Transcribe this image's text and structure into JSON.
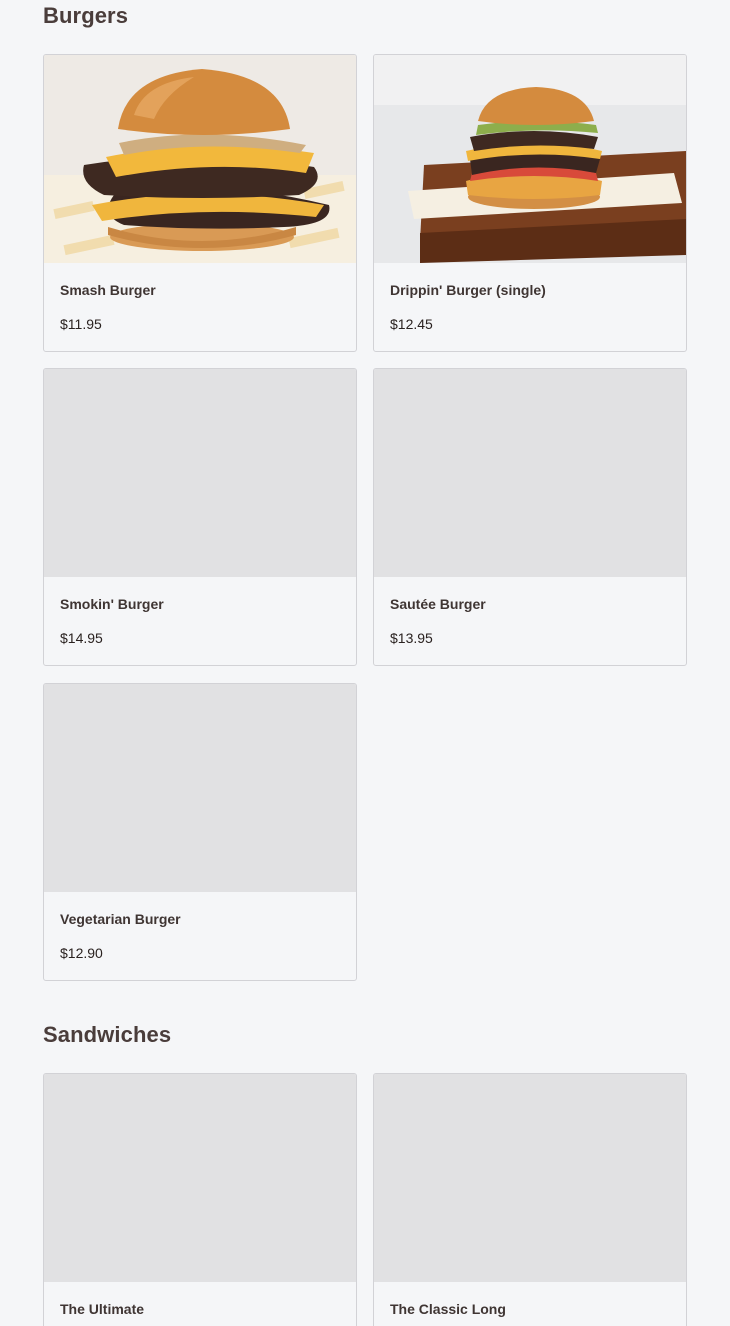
{
  "sections": [
    {
      "title": "Burgers",
      "items": [
        {
          "name": "Smash Burger",
          "price": "$11.95",
          "image": "smash-burger-photo"
        },
        {
          "name": "Drippin' Burger (single)",
          "price": "$12.45",
          "image": "drippin-burger-photo"
        },
        {
          "name": "Smokin' Burger",
          "price": "$14.95",
          "image": "placeholder"
        },
        {
          "name": "Sautée Burger",
          "price": "$13.95",
          "image": "placeholder"
        },
        {
          "name": "Vegetarian Burger",
          "price": "$12.90",
          "image": "placeholder"
        }
      ]
    },
    {
      "title": "Sandwiches",
      "items": [
        {
          "name": "The Ultimate",
          "image": "placeholder"
        },
        {
          "name": "The Classic Long",
          "image": "placeholder"
        }
      ]
    }
  ],
  "colors": {
    "background": "#f5f6f8",
    "card_border": "#d2d2d6",
    "image_placeholder": "#e1e1e3",
    "heading_text": "#4a3d3b"
  }
}
